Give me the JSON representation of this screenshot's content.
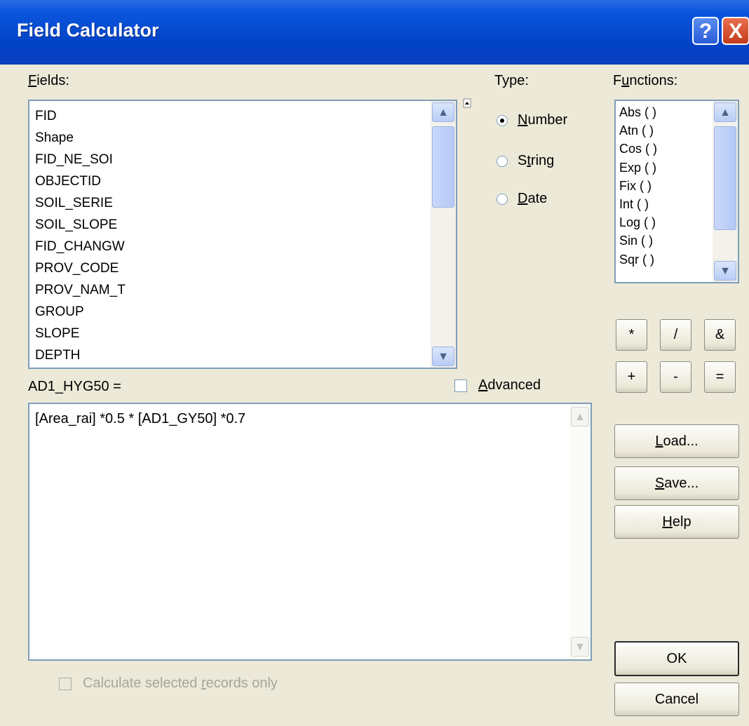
{
  "window": {
    "title": "Field Calculator"
  },
  "fields": {
    "label_prefix": "",
    "label_mnemonic": "F",
    "label_rest": "ields:",
    "items": [
      "FID",
      "Shape",
      "FID_NE_SOI",
      "OBJECTID",
      "SOIL_SERIE",
      "SOIL_SLOPE",
      "FID_CHANGW",
      "PROV_CODE",
      "PROV_NAM_T",
      "GROUP",
      "SLOPE",
      "DEPTH"
    ]
  },
  "type": {
    "label": "Type:",
    "options": [
      {
        "pre": "",
        "mn": "N",
        "post": "umber",
        "selected": true
      },
      {
        "pre": "S",
        "mn": "t",
        "post": "ring",
        "selected": false
      },
      {
        "pre": "",
        "mn": "D",
        "post": "ate",
        "selected": false
      }
    ]
  },
  "functions": {
    "label_prefix": "F",
    "label_mnemonic": "u",
    "label_rest": "nctions:",
    "items": [
      "Abs ( )",
      "Atn ( )",
      "Cos ( )",
      "Exp ( )",
      "Fix ( )",
      "Int ( )",
      "Log ( )",
      "Sin ( )",
      "Sqr ( )"
    ]
  },
  "operators": [
    "*",
    "/",
    "&",
    "+",
    "-",
    "="
  ],
  "expression": {
    "target_label": "AD1_HYG50 =",
    "text": "[Area_rai] *0.5 * [AD1_GY50] *0.7"
  },
  "advanced": {
    "mnemonic": "A",
    "rest": "dvanced",
    "checked": false
  },
  "buttons": {
    "load": {
      "mn": "L",
      "rest": "oad..."
    },
    "save": {
      "mn": "S",
      "rest": "ave..."
    },
    "help": {
      "mn": "H",
      "rest": "elp"
    },
    "ok": "OK",
    "cancel": "Cancel"
  },
  "calc_selected": {
    "pre": "Calculate selected ",
    "mn": "r",
    "post": "ecords only",
    "enabled": false
  },
  "icons": {
    "help": "?",
    "close": "X",
    "scroll_up": "▲",
    "scroll_down": "▼"
  }
}
